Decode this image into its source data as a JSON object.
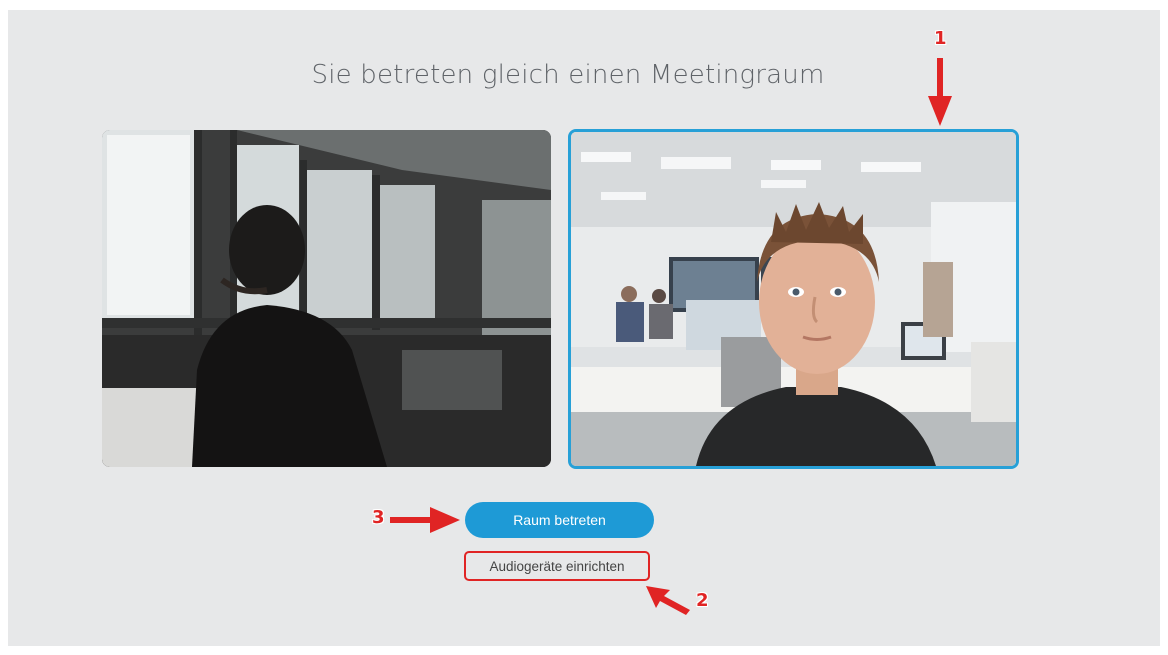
{
  "page": {
    "title": "Sie betreten gleich einen Meetingraum"
  },
  "videos": {
    "left": {
      "name": "remote participant video"
    },
    "right": {
      "name": "local camera preview",
      "border_color": "#27a0d7"
    }
  },
  "actions": {
    "join_label": "Raum betreten",
    "audio_label": "Audiogeräte einrichten",
    "join_color": "#1e9ad6"
  },
  "annotations": {
    "callout_1": "1",
    "callout_2": "2",
    "callout_3": "3",
    "color": "#e02424"
  }
}
